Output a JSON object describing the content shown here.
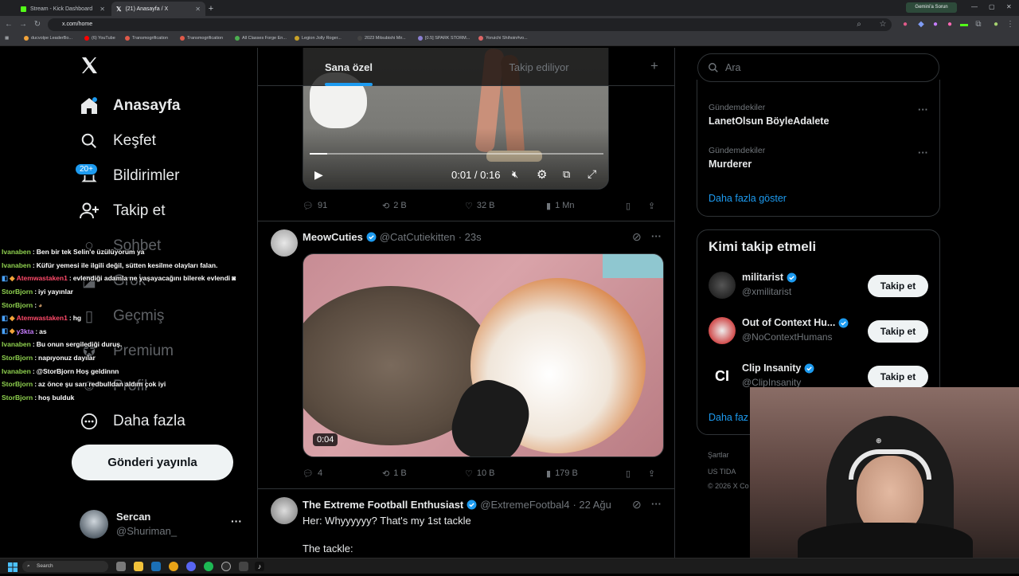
{
  "browser": {
    "tabs": [
      {
        "title": "Stream - Kick Dashboard",
        "active": false
      },
      {
        "title": "(21) Anasayfa / X",
        "active": true
      }
    ],
    "url": "x.com/home",
    "gemini_label": "Gemini'a Sorun",
    "bookmarks": [
      "ducvolpe LeaderBo...",
      "(6) YouTube",
      "Transmogrification",
      "Transmogrification",
      "All Classes Forge En...",
      "Legion Jolly Roger...",
      "2023 Mitsubishi Mir...",
      "[0.5] SPARK STORM...",
      "Yoruichi Shihoin#vo..."
    ]
  },
  "nav": {
    "home": "Anasayfa",
    "explore": "Keşfet",
    "notifications": "Bildirimler",
    "notif_badge": "20+",
    "follow": "Takip et",
    "chat": "Sohbet",
    "grok": "Grok",
    "history": "Geçmiş",
    "premium": "Premium",
    "profile": "Profil",
    "more": "Daha fazla",
    "post_button": "Gönderi yayınla",
    "user_name": "Sercan",
    "user_handle": "@Shuriman_"
  },
  "chat": [
    {
      "user": "Ivanaben",
      "color": "#8fd14f",
      "msg": "Ben bir tek Selin'e üzülüyorum ya"
    },
    {
      "user": "Ivanaben",
      "color": "#8fd14f",
      "msg": "Küfür yemesi ile ilgili değil, sütten kesilme olayları falan."
    },
    {
      "user": "Atemwastaken1",
      "color": "#ff4a6a",
      "msg": "evlendiği adamla ne yaşayacağını bilerek evlendi"
    },
    {
      "user": "StorBjorn",
      "color": "#8fd14f",
      "msg": "iyi yayınlar"
    },
    {
      "user": "StorBjorn",
      "color": "#8fd14f",
      "msg": ""
    },
    {
      "user": "Atemwastaken1",
      "color": "#ff4a6a",
      "msg": "hg"
    },
    {
      "user": "y3kta",
      "color": "#c77dff",
      "msg": "as"
    },
    {
      "user": "Ivanaben",
      "color": "#8fd14f",
      "msg": "Bu onun sergilediği duruş."
    },
    {
      "user": "StorBjorn",
      "color": "#8fd14f",
      "msg": "napıyonuz dayılar"
    },
    {
      "user": "Ivanaben",
      "color": "#8fd14f",
      "msg": "@StorBjorn Hoş geldinnn"
    },
    {
      "user": "StorBjorn",
      "color": "#8fd14f",
      "msg": "az önce şu sarı redbulldan aldım çok iyi"
    },
    {
      "user": "StorBjorn",
      "color": "#8fd14f",
      "msg": "hoş bulduk"
    }
  ],
  "feed": {
    "tab_foryou": "Sana özel",
    "tab_following": "Takip ediliyor",
    "video1": {
      "time": "0:01 / 0:16",
      "progress": 0.06
    },
    "post1_stats": {
      "replies": "91",
      "reposts": "2 B",
      "likes": "32 B",
      "views": "1 Mn"
    },
    "post2": {
      "name": "MeowCuties",
      "handle": "@CatCutiekitten",
      "time": "· 23s",
      "duration": "0:04",
      "replies": "4",
      "reposts": "1 B",
      "likes": "10 B",
      "views": "179 B"
    },
    "post3": {
      "name": "The Extreme Football Enthusiast",
      "handle": "@ExtremeFootbal4",
      "time": "· 22 Ağu",
      "line1": "Her: Whyyyyyy? That's my 1st tackle",
      "line2": "The tackle:"
    }
  },
  "right": {
    "search_placeholder": "Ara",
    "trends": [
      {
        "category": "Gündemdekiler",
        "name": "LanetOlsun BöyleAdalete"
      },
      {
        "category": "Gündemdekiler",
        "name": "Murderer"
      }
    ],
    "show_more": "Daha fazla göster",
    "wtf_title": "Kimi takip etmeli",
    "wtf": [
      {
        "name": "militarist",
        "handle": "@xmilitarist",
        "button": "Takip et"
      },
      {
        "name": "Out of Context Hu...",
        "handle": "@NoContextHumans",
        "button": "Takip et"
      },
      {
        "name": "Clip Insanity",
        "handle": "@ClipInsanity",
        "button": "Takip et"
      }
    ],
    "show_more2": "Daha faz",
    "footer1": "Şartlar",
    "footer2": "US TIDA",
    "footer3": "© 2026 X Co"
  },
  "taskbar": {
    "search": "Search"
  },
  "colors": {
    "accent": "#1d9bf0",
    "bg": "#000000",
    "border": "#2f3336"
  }
}
